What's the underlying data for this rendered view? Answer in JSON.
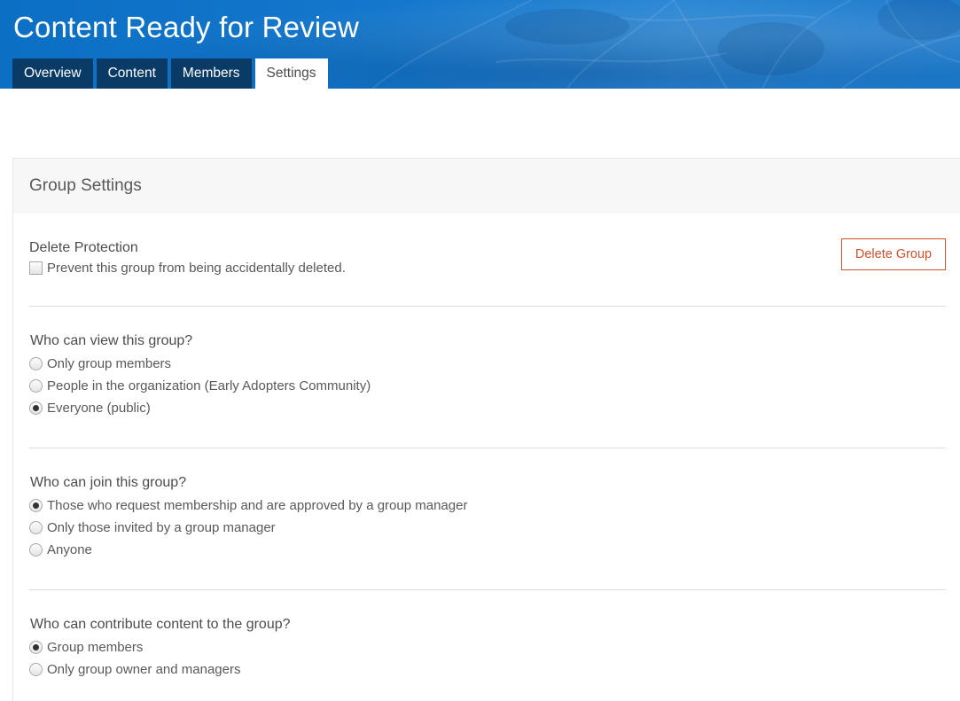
{
  "header": {
    "title": "Content Ready for Review",
    "tabs": [
      {
        "label": "Overview",
        "active": false
      },
      {
        "label": "Content",
        "active": false
      },
      {
        "label": "Members",
        "active": false
      },
      {
        "label": "Settings",
        "active": true
      }
    ]
  },
  "settings": {
    "title": "Group Settings",
    "delete_protection": {
      "title": "Delete Protection",
      "checkbox_label": "Prevent this group from being accidentally deleted.",
      "checked": false,
      "delete_button": "Delete Group"
    },
    "view": {
      "title": "Who can view this group?",
      "options": [
        {
          "label": "Only group members",
          "checked": false
        },
        {
          "label": "People in the organization (Early Adopters Community)",
          "checked": false
        },
        {
          "label": "Everyone (public)",
          "checked": true
        }
      ]
    },
    "join": {
      "title": "Who can join this group?",
      "options": [
        {
          "label": "Those who request membership and are approved by a group manager",
          "checked": true
        },
        {
          "label": "Only those invited by a group manager",
          "checked": false
        },
        {
          "label": "Anyone",
          "checked": false
        }
      ]
    },
    "contribute": {
      "title": "Who can contribute content to the group?",
      "options": [
        {
          "label": "Group members",
          "checked": true
        },
        {
          "label": "Only group owner and managers",
          "checked": false
        }
      ]
    }
  },
  "colors": {
    "header_blue": "#1477cc",
    "tab_dark": "#0a3a66",
    "delete_red": "#d0502a"
  }
}
